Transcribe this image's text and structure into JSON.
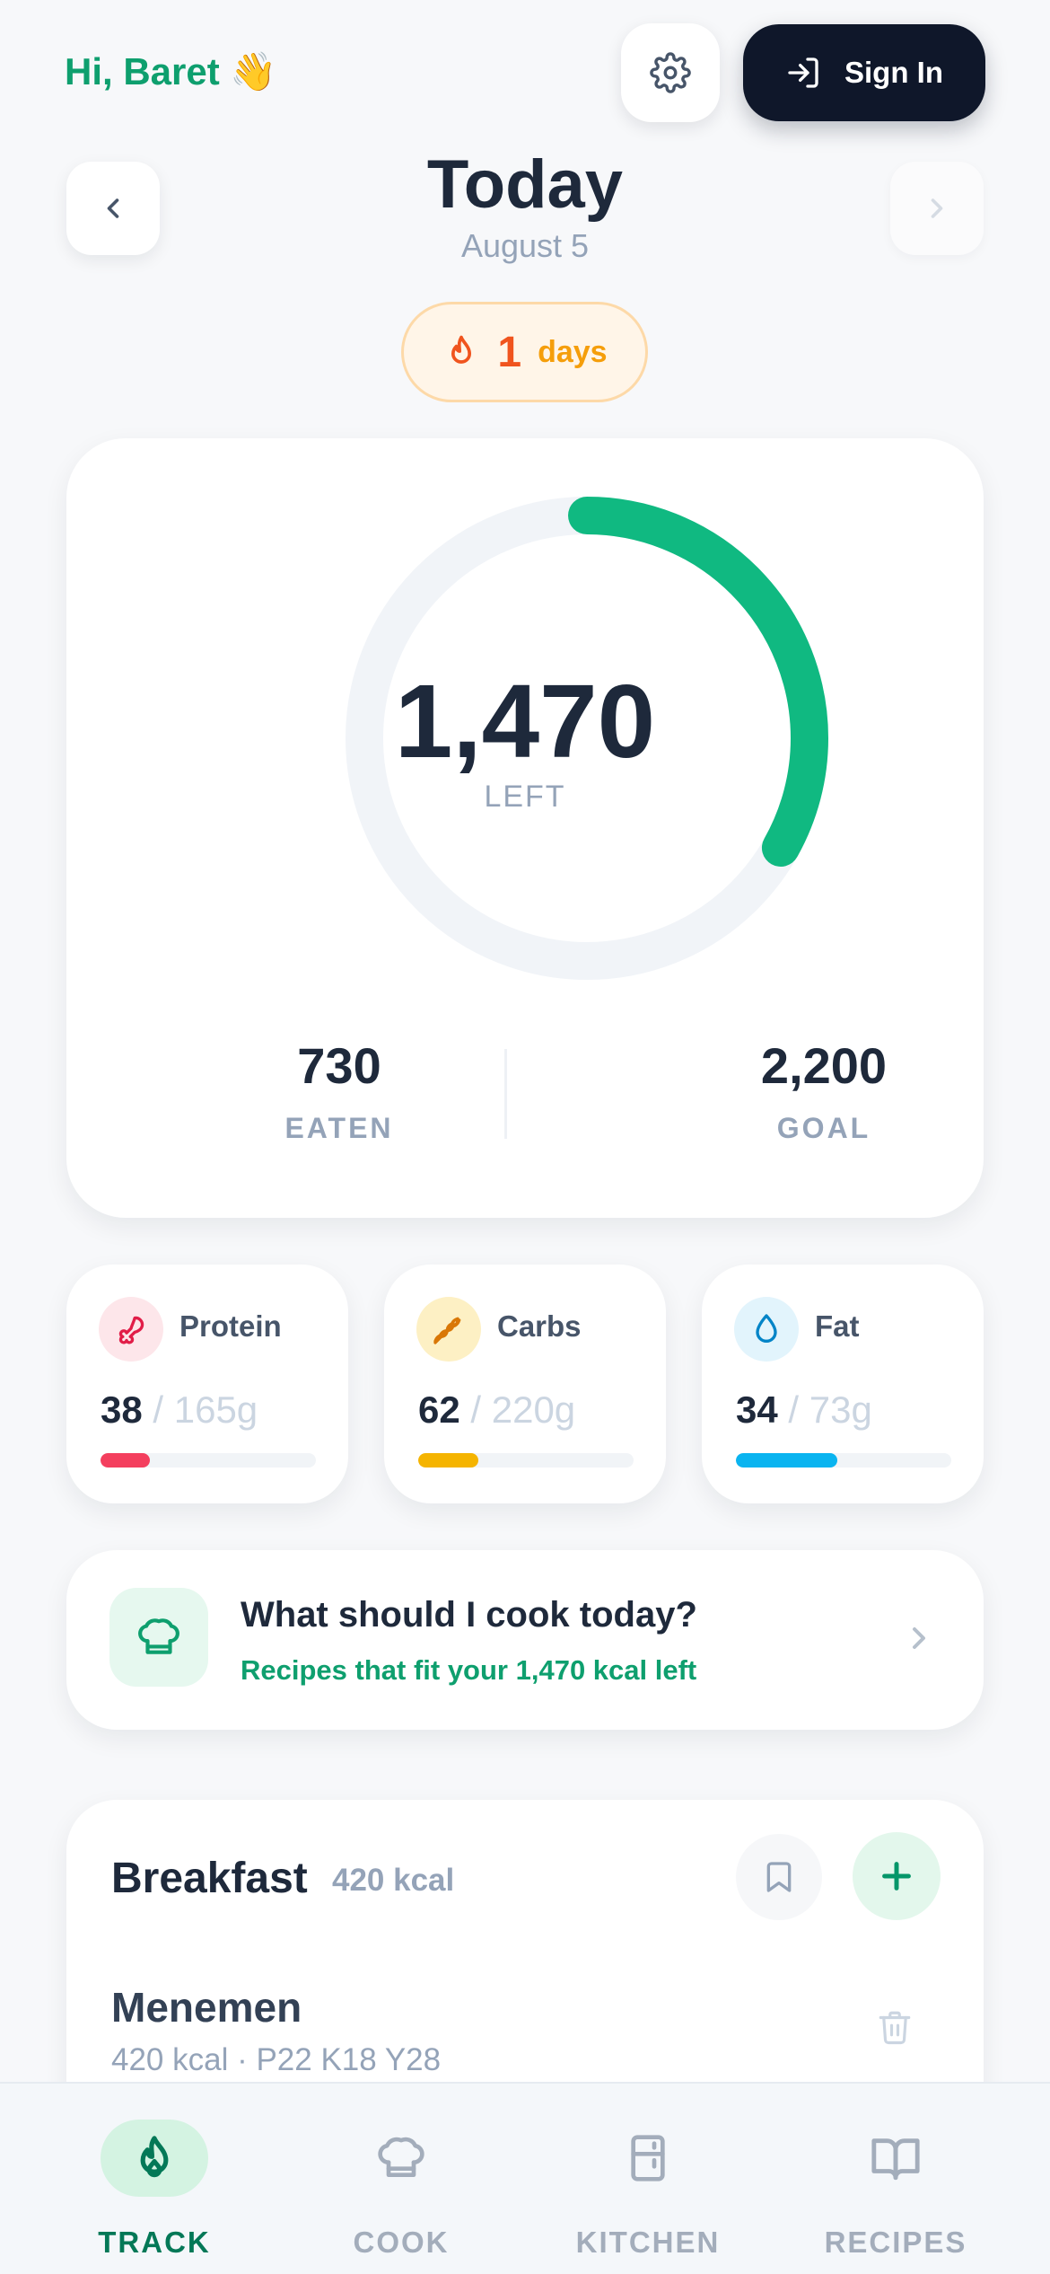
{
  "header": {
    "greeting": "Hi, Baret 👋",
    "sign_in_label": "Sign In"
  },
  "day": {
    "title": "Today",
    "date": "August 5"
  },
  "streak": {
    "count": "1",
    "unit": "days"
  },
  "calories": {
    "left_value": "1,470",
    "left_label": "LEFT",
    "eaten_value": "730",
    "eaten_label": "EATEN",
    "goal_value": "2,200",
    "goal_label": "GOAL",
    "eaten_fraction": 0.3318
  },
  "macros": [
    {
      "name": "Protein",
      "amount": "38",
      "goal": " / 165g",
      "fraction": 0.23,
      "color": "#f43f5e",
      "icon_bg": "#fde6ea",
      "icon": "meat-icon"
    },
    {
      "name": "Carbs",
      "amount": "62",
      "goal": " / 220g",
      "fraction": 0.28,
      "color": "#f5b400",
      "icon_bg": "#fdf0c4",
      "icon": "wheat-icon"
    },
    {
      "name": "Fat",
      "amount": "34",
      "goal": " / 73g",
      "fraction": 0.47,
      "color": "#0ab4f0",
      "icon_bg": "#e2f4fc",
      "icon": "droplet-icon"
    }
  ],
  "suggestion": {
    "title": "What should I cook today?",
    "subtitle": "Recipes that fit your 1,470 kcal left"
  },
  "meal": {
    "title": "Breakfast",
    "kcal": "420 kcal",
    "items": [
      {
        "name": "Menemen",
        "detail": "420 kcal · P22 K18 Y28"
      }
    ]
  },
  "tabs": [
    {
      "label": "TRACK",
      "active": true,
      "icon": "flame-icon"
    },
    {
      "label": "COOK",
      "active": false,
      "icon": "chef-hat-icon"
    },
    {
      "label": "KITCHEN",
      "active": false,
      "icon": "fridge-icon"
    },
    {
      "label": "RECIPES",
      "active": false,
      "icon": "book-icon"
    }
  ],
  "colors": {
    "accent_green": "#10b981",
    "greeting_green": "#0e9f6e",
    "streak_orange": "#f0541e",
    "dark": "#0f172a"
  }
}
